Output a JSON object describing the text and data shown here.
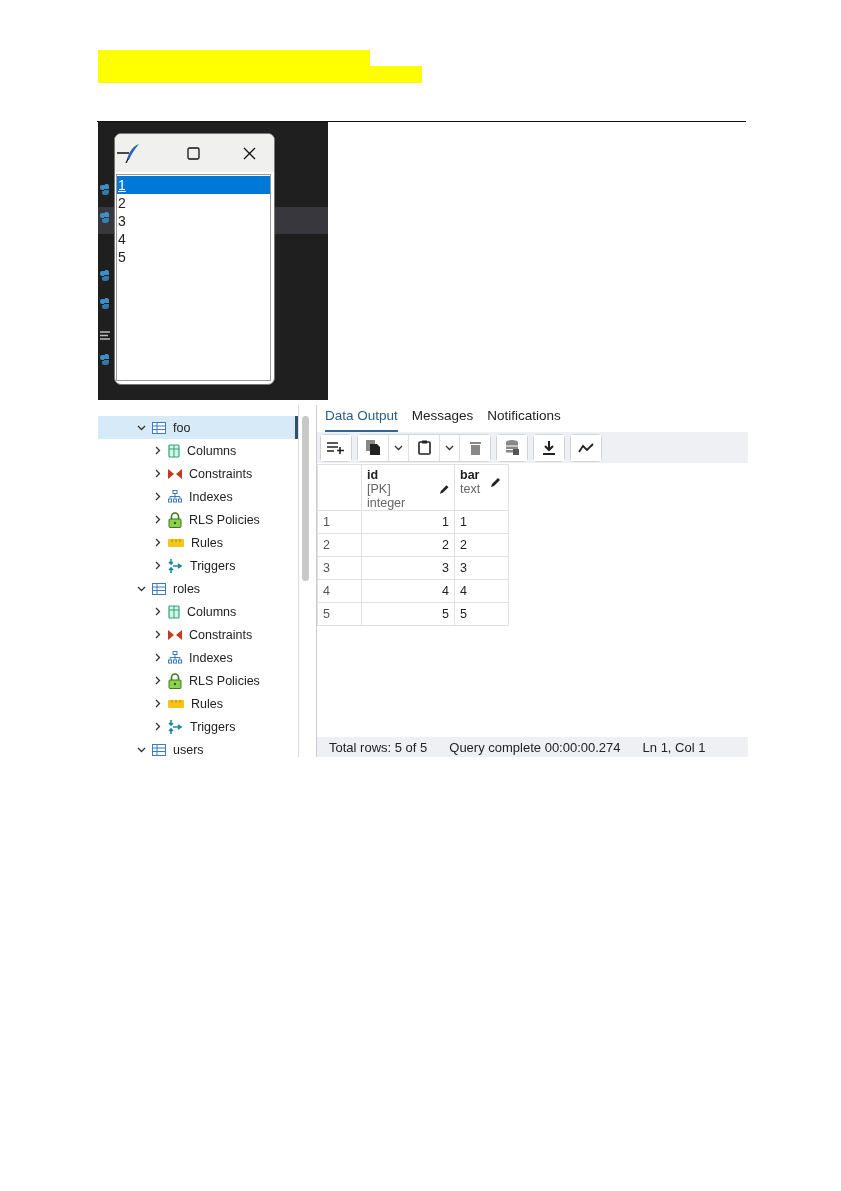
{
  "tk_window": {
    "items": [
      {
        "label": "1",
        "selected": true
      },
      {
        "label": "2",
        "selected": false
      },
      {
        "label": "3",
        "selected": false
      },
      {
        "label": "4",
        "selected": false
      },
      {
        "label": "5",
        "selected": false
      }
    ]
  },
  "tree": [
    {
      "label": "foo",
      "expanded": true,
      "selected": true,
      "children": [
        {
          "label": "Columns",
          "kind": "columns",
          "expanded": false
        },
        {
          "label": "Constraints",
          "kind": "constraints",
          "expanded": false
        },
        {
          "label": "Indexes",
          "kind": "indexes",
          "expanded": false
        },
        {
          "label": "RLS Policies",
          "kind": "policies",
          "expanded": false
        },
        {
          "label": "Rules",
          "kind": "rules",
          "expanded": false
        },
        {
          "label": "Triggers",
          "kind": "triggers",
          "expanded": false
        }
      ]
    },
    {
      "label": "roles",
      "expanded": true,
      "selected": false,
      "children": [
        {
          "label": "Columns",
          "kind": "columns",
          "expanded": false
        },
        {
          "label": "Constraints",
          "kind": "constraints",
          "expanded": false
        },
        {
          "label": "Indexes",
          "kind": "indexes",
          "expanded": false
        },
        {
          "label": "RLS Policies",
          "kind": "policies",
          "expanded": false
        },
        {
          "label": "Rules",
          "kind": "rules",
          "expanded": false
        },
        {
          "label": "Triggers",
          "kind": "triggers",
          "expanded": false
        }
      ]
    },
    {
      "label": "users",
      "expanded": true,
      "selected": false
    }
  ],
  "tabs": [
    {
      "label": "Data Output",
      "selected": true
    },
    {
      "label": "Messages",
      "selected": false
    },
    {
      "label": "Notifications",
      "selected": false
    }
  ],
  "grid": {
    "columns": [
      {
        "name": "id",
        "type": "[PK] integer"
      },
      {
        "name": "bar",
        "type": "text"
      }
    ],
    "rows": [
      {
        "row_number": "1",
        "cells": [
          "1",
          "1"
        ]
      },
      {
        "row_number": "2",
        "cells": [
          "2",
          "2"
        ]
      },
      {
        "row_number": "3",
        "cells": [
          "3",
          "3"
        ]
      },
      {
        "row_number": "4",
        "cells": [
          "4",
          "4"
        ]
      },
      {
        "row_number": "5",
        "cells": [
          "5",
          "5"
        ]
      }
    ]
  },
  "status_bar": [
    "Total rows: 5 of 5",
    "Query complete 00:00:00.274",
    "Ln 1, Col 1"
  ]
}
